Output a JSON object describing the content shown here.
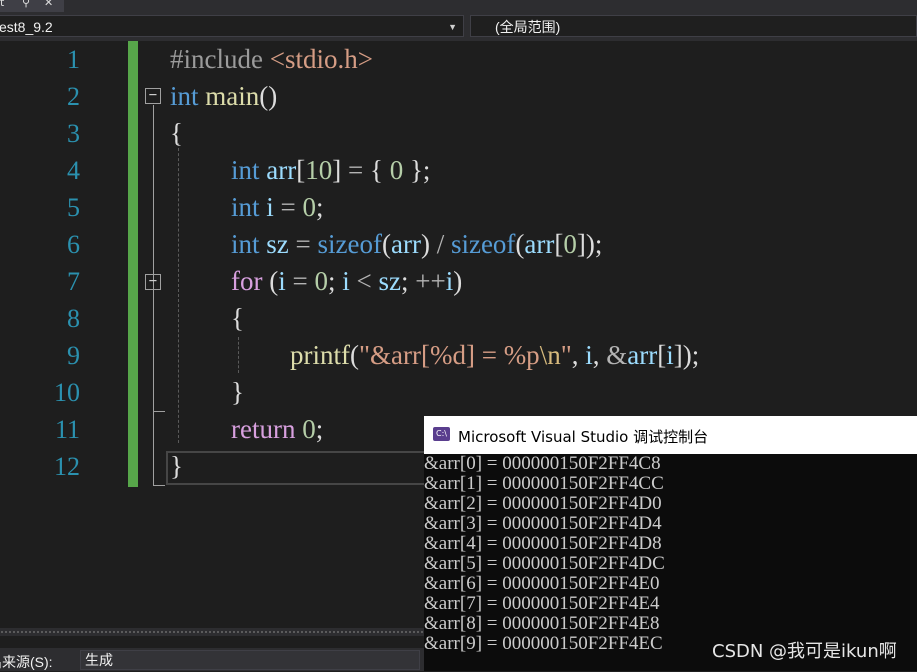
{
  "tabs": {
    "fragment": "t",
    "pin_icon": "pin-icon",
    "close_icon": "close-icon"
  },
  "navbar": {
    "project_dropdown": "est8_9.2",
    "scope_dropdown": "(全局范围)"
  },
  "editor": {
    "line_numbers": [
      "1",
      "2",
      "3",
      "4",
      "5",
      "6",
      "7",
      "8",
      "9",
      "10",
      "11",
      "12"
    ]
  },
  "console": {
    "title": "Microsoft Visual Studio 调试控制台",
    "icon_label": "C:\\",
    "lines": [
      "&arr[0] = 000000150F2FF4C8",
      "&arr[1] = 000000150F2FF4CC",
      "&arr[2] = 000000150F2FF4D0",
      "&arr[3] = 000000150F2FF4D4",
      "&arr[4] = 000000150F2FF4D8",
      "&arr[5] = 000000150F2FF4DC",
      "&arr[6] = 000000150F2FF4E0",
      "&arr[7] = 000000150F2FF4E4",
      "&arr[8] = 000000150F2FF4E8",
      "&arr[9] = 000000150F2FF4EC"
    ]
  },
  "output_bar": {
    "source_label": "出来源(S):",
    "source_value": "生成"
  },
  "watermark": "CSDN @我可是ikun啊"
}
